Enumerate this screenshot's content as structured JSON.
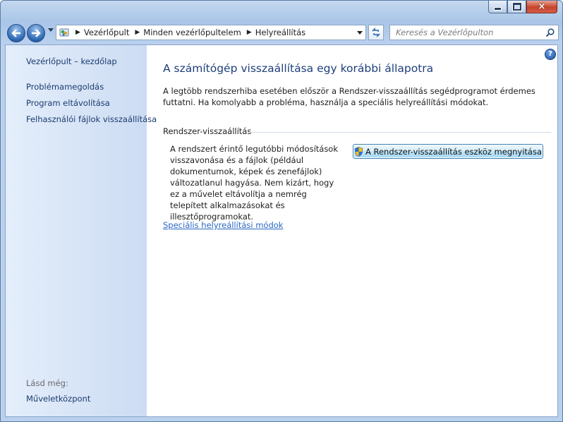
{
  "window": {
    "buttons": {
      "minimize": "minimize",
      "maximize": "maximize",
      "close": "×"
    }
  },
  "navigation": {
    "back_icon": "back-arrow-icon",
    "forward_icon": "forward-arrow-icon",
    "breadcrumbs": [
      "Vezérlőpult",
      "Minden vezérlőpultelem",
      "Helyreállítás"
    ],
    "search_placeholder": "Keresés a Vezérlőpulton"
  },
  "sidebar": {
    "home_link": "Vezérlőpult – kezdőlap",
    "links": [
      "Problémamegoldás",
      "Program eltávolítása",
      "Felhasználói fájlok visszaállítása"
    ],
    "see_also_label": "Lásd még:",
    "see_also_links": [
      "Műveletközpont"
    ]
  },
  "main": {
    "title": "A számítógép visszaállítása egy korábbi állapotra",
    "intro": "A legtöbb rendszerhiba esetében először a Rendszer-visszaállítás segédprogramot érdemes futtatni. Ha komolyabb a probléma, használja a speciális helyreállítási módokat.",
    "section_heading": "Rendszer-visszaállítás",
    "section_description": "A rendszert érintő legutóbbi módosítások visszavonása és a fájlok (például dokumentumok, képek és zenefájlok) változatlanul hagyása. Nem kizárt, hogy ez a művelet eltávolítja a nemrég telepített alkalmazásokat és illesztőprogramokat.",
    "restore_button": "A Rendszer-visszaállítás eszköz megnyitása",
    "advanced_link": "Speciális helyreállítási módok",
    "help_icon": "?"
  },
  "colors": {
    "title_blue": "#1e3f7b",
    "link_blue": "#2b67c4",
    "sidebar_link": "#1c3b6e"
  }
}
